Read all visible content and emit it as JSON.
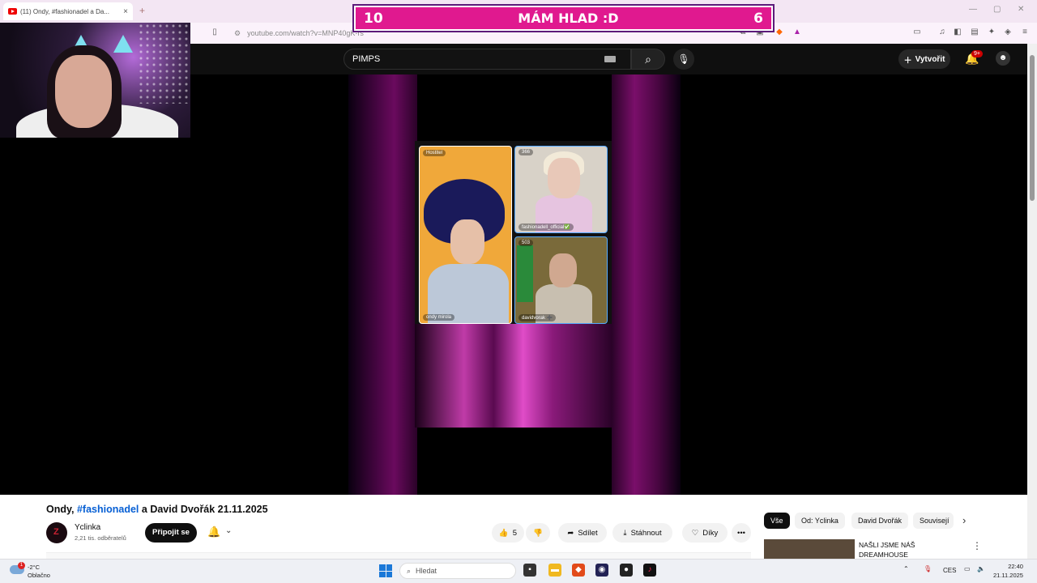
{
  "browser": {
    "tab_title": "(11) Ondy, #fashionadel a Da...",
    "tab_close": "×",
    "new_tab": "+",
    "url": "youtube.com/watch?v=MNP40gK-rs",
    "window_controls": [
      "—",
      "▢",
      "✕"
    ]
  },
  "overlay": {
    "left_number": "10",
    "text": "MÁM HLAD :D",
    "right_number": "6"
  },
  "youtube": {
    "search_value": "PIMPS",
    "create_label": "Vytvořit",
    "notifications_badge": "9+",
    "video_tiles": {
      "host_tag": "Hostitel",
      "viewers_b": "366",
      "viewers_c": "503",
      "name_a": "ondy mirola",
      "name_b": "fashionadell_official✅",
      "name_c": "davidvorak ➕"
    },
    "video_title_prefix": "Ondy,",
    "video_title_hashtag": "#fashionadel",
    "video_title_suffix": "a David Dvořák 21.11.2025",
    "channel_name": "Yclinka",
    "subscribers": "2,21 tis. odběratelů",
    "join_label": "Připojit se",
    "like_count": "5",
    "share_label": "Sdílet",
    "download_label": "Stáhnout",
    "thanks_label": "Díky",
    "more_label": "•••",
    "chips": [
      "Vše",
      "Od: Yclinka",
      "David Dvořák",
      "Souvisejí"
    ],
    "related_title": "NAŠLI JSME NÁŠ DREAMHOUSE"
  },
  "taskbar": {
    "weather_badge": "1",
    "temperature": "-2°C",
    "condition": "Oblačno",
    "search_placeholder": "Hledat",
    "language": "CES",
    "time": "22:40",
    "date": "21.11.2025"
  },
  "colors": {
    "banner_pink": "#e0198f",
    "youtube_dark": "#0f0f0f",
    "link_blue": "#065fd4"
  }
}
